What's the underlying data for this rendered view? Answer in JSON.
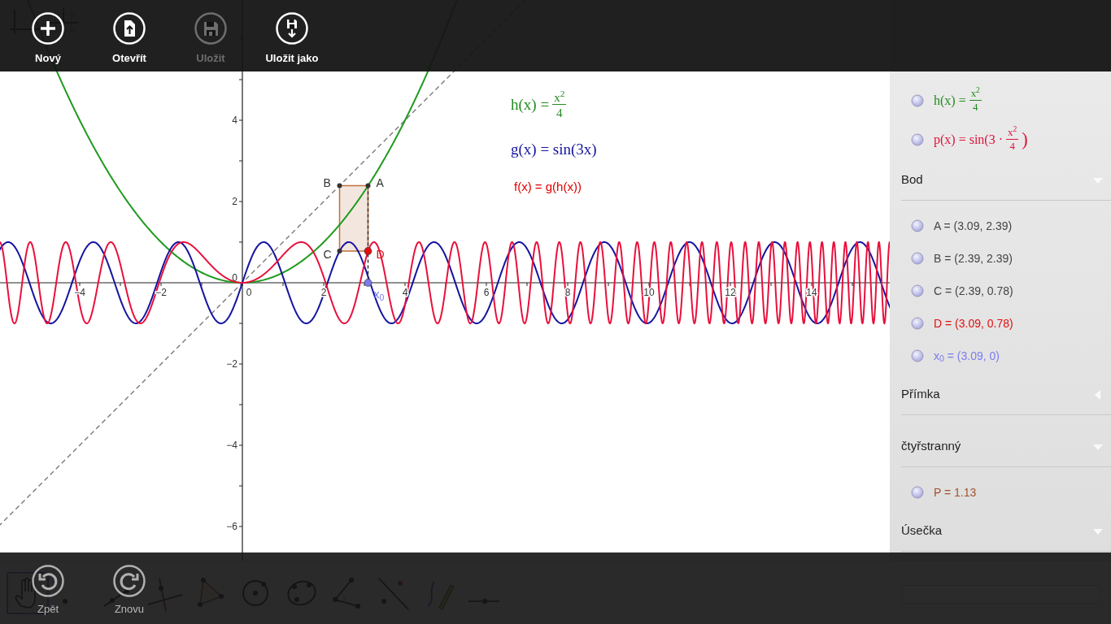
{
  "app_bar": {
    "buttons": [
      {
        "kind": "new",
        "label": "Nový",
        "disabled": false
      },
      {
        "kind": "open",
        "label": "Otevřít",
        "disabled": false
      },
      {
        "kind": "save",
        "label": "Uložit",
        "disabled": true
      },
      {
        "kind": "save_as",
        "label": "Uložit jako",
        "disabled": false
      }
    ]
  },
  "graphics": {
    "x_ticks": [
      "−4",
      "−2",
      "0",
      "2",
      "4",
      "6",
      "8",
      "10",
      "12",
      "14"
    ],
    "y_ticks": [
      "4",
      "2",
      "0",
      "−2",
      "−4",
      "−6"
    ],
    "curves": [
      {
        "kind": "diagonal",
        "color": "#707070"
      },
      {
        "kind": "parabola",
        "color": "#1e9a1e"
      },
      {
        "kind": "sine",
        "color": "#1414a0"
      },
      {
        "kind": "composite",
        "color": "#e8103c"
      }
    ],
    "points": [
      {
        "label": "B",
        "color": "#333333"
      },
      {
        "label": "A",
        "color": "#333333"
      },
      {
        "label": "C",
        "color": "#333333"
      },
      {
        "label": "D",
        "color": "#e01010"
      },
      {
        "label": "x$_{0}$",
        "color": "#7b7bee"
      }
    ],
    "captions": [
      {
        "kind": "fraction",
        "lhs": "h(x) =",
        "num": "x$^{2}$",
        "den": "4",
        "color": "#228b22"
      },
      {
        "kind": "serif",
        "text": "g(x) = sin(3x)",
        "color": "#1414a0"
      },
      {
        "kind": "sans",
        "text": "f(x) = g(h(x))",
        "color": "#e00000"
      }
    ]
  },
  "algebra": {
    "sections": [
      {
        "items": [
          {
            "kind": "fraction",
            "lhs": "h(x) =",
            "num": "x$^{2}$",
            "den": "4",
            "color": "#228b22"
          },
          {
            "kind": "fraction",
            "lhs": "p(x) = sin(3 ·",
            "num": "x$^{2}$",
            "den": "4",
            "rhs": ")",
            "color": "#dc143c"
          }
        ]
      },
      {
        "title": "Bod",
        "expanded": true,
        "items": [
          {
            "kind": "sans",
            "text": "A = (3.09, 2.39)",
            "color": "#444444"
          },
          {
            "kind": "sans",
            "text": "B = (2.39, 2.39)",
            "color": "#444444"
          },
          {
            "kind": "sans",
            "text": "C = (2.39, 0.78)",
            "color": "#444444"
          },
          {
            "kind": "sans",
            "text": "D = (3.09, 0.78)",
            "color": "#e01010"
          },
          {
            "kind": "sans",
            "text": "x$_{0}$ = (3.09, 0)",
            "color": "#7b7bee"
          }
        ]
      },
      {
        "title": "Přímka",
        "expanded": false
      },
      {
        "title": "čtyřstranný",
        "expanded": true,
        "items": [
          {
            "kind": "sans",
            "text": "P = 1.13",
            "color": "#a0522d"
          }
        ]
      },
      {
        "title": "Úsečka",
        "expanded": true
      }
    ]
  },
  "toolbar": {
    "tools": [
      {
        "kind": "move",
        "selected": true
      },
      {
        "kind": "point",
        "selected": false
      },
      {
        "kind": "line",
        "selected": false
      },
      {
        "kind": "perpendicular",
        "selected": false
      },
      {
        "kind": "polygon",
        "selected": false
      },
      {
        "kind": "circle",
        "selected": false
      },
      {
        "kind": "conic",
        "selected": false
      },
      {
        "kind": "angle",
        "selected": false
      },
      {
        "kind": "reflect",
        "selected": false
      },
      {
        "kind": "pen",
        "selected": false
      },
      {
        "kind": "slider",
        "selected": false
      }
    ]
  },
  "bottom_bar": {
    "buttons": [
      {
        "kind": "undo",
        "label": "Zpět"
      },
      {
        "kind": "redo",
        "label": "Znovu"
      }
    ]
  }
}
